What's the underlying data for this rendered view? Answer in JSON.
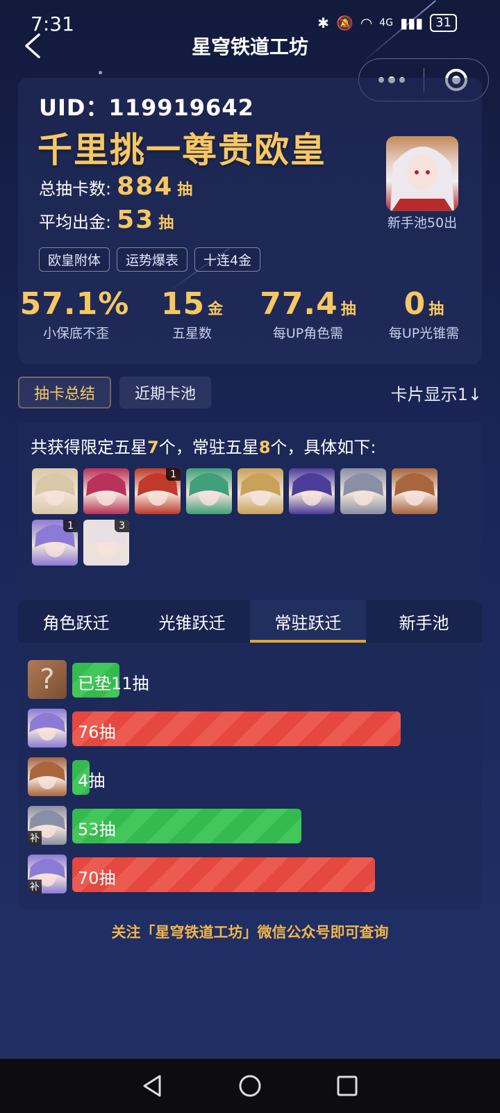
{
  "status": {
    "time": "7:31",
    "battery": "31",
    "network": "4G"
  },
  "header": {
    "title": "星穹铁道工坊"
  },
  "summary": {
    "uid": "UID：119919642",
    "rank_title": "千里挑一尊贵欧皇",
    "total_label": "总抽卡数:",
    "total_value": "884",
    "total_unit": "抽",
    "avg_label": "平均出金:",
    "avg_value": "53",
    "avg_unit": "抽",
    "avatar_caption": "新手池50出",
    "tags": [
      "欧皇附体",
      "运势爆表",
      "十连4金"
    ],
    "metrics": [
      {
        "value": "57.1%",
        "unit": "",
        "label": "小保底不歪"
      },
      {
        "value": "15",
        "unit": "金",
        "label": "五星数"
      },
      {
        "value": "77.4",
        "unit": "抽",
        "label": "每UP角色需"
      },
      {
        "value": "0",
        "unit": "抽",
        "label": "每UP光锥需"
      }
    ]
  },
  "view_tabs": {
    "summary": "抽卡总结",
    "recent": "近期卡池",
    "display_toggle": "卡片显示1↓"
  },
  "five_star": {
    "title_prefix": "共获得限定五星",
    "limited_count": "7",
    "title_mid": "个，常驻五星",
    "standard_count": "8",
    "title_suffix": "个，具体如下:",
    "characters": [
      {
        "name": "char-1",
        "badge": "",
        "color": "#d9c8a8"
      },
      {
        "name": "char-2",
        "badge": "",
        "color": "#b8325a"
      },
      {
        "name": "char-3",
        "badge": "1",
        "color": "#c0392b"
      },
      {
        "name": "char-4",
        "badge": "",
        "color": "#3fa07a"
      },
      {
        "name": "char-5",
        "badge": "",
        "color": "#c9a25a"
      },
      {
        "name": "char-6",
        "badge": "",
        "color": "#4c3d9c"
      },
      {
        "name": "lightcone-1",
        "badge": "",
        "color": "#8a8fa6"
      },
      {
        "name": "char-8",
        "badge": "",
        "color": "#a8653e"
      },
      {
        "name": "char-9",
        "badge": "1",
        "color": "#8c7bd6"
      },
      {
        "name": "char-10",
        "badge": "3",
        "color": "#e8e0e4"
      }
    ]
  },
  "warp": {
    "tabs": [
      "角色跃迁",
      "光锥跃迁",
      "常驻跃迁",
      "新手池"
    ],
    "active_tab": 2,
    "rows": [
      {
        "label": "已垫11抽",
        "pulls": 11,
        "status": "green",
        "avatar": "?",
        "color": "#a67654",
        "bu": ""
      },
      {
        "label": "76抽",
        "pulls": 76,
        "status": "red",
        "avatar": "",
        "color": "#8c7bd6",
        "bu": ""
      },
      {
        "label": "4抽",
        "pulls": 4,
        "status": "green",
        "avatar": "",
        "color": "#a8653e",
        "bu": ""
      },
      {
        "label": "53抽",
        "pulls": 53,
        "status": "green",
        "avatar": "",
        "color": "#8a8fa6",
        "bu": "补"
      },
      {
        "label": "70抽",
        "pulls": 70,
        "status": "red",
        "avatar": "",
        "color": "#8c7bd6",
        "bu": "补"
      }
    ]
  },
  "footer": {
    "text": "关注「星穹铁道工坊」微信公众号即可查询"
  }
}
